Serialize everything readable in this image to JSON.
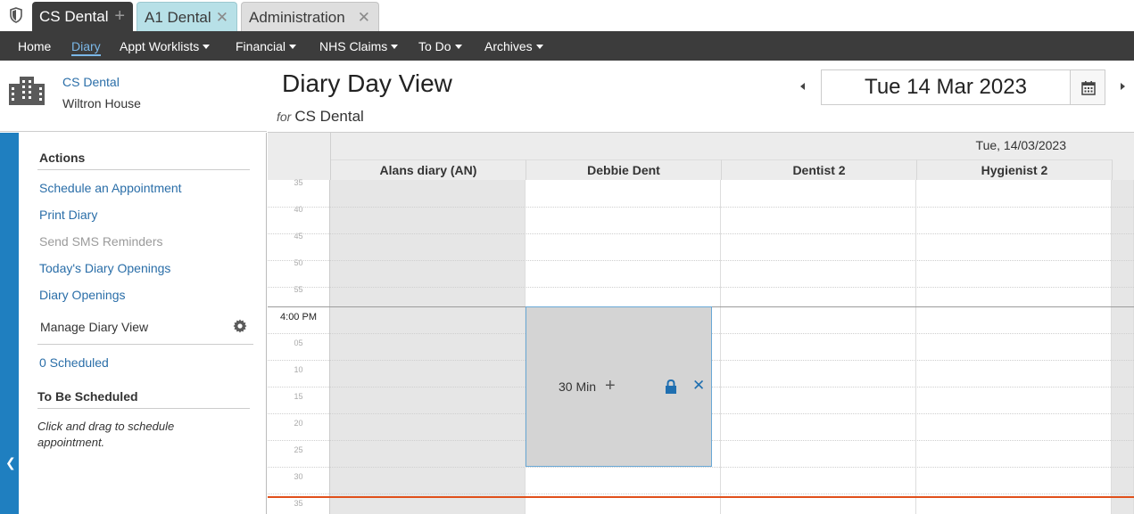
{
  "tabs": [
    {
      "label": "CS Dental",
      "icon": "plus-icon",
      "glyph": "+"
    },
    {
      "label": "A1 Dental",
      "icon": "close-icon",
      "glyph": "✕"
    },
    {
      "label": "Administration",
      "icon": "close-icon",
      "glyph": "✕"
    }
  ],
  "nav": {
    "home": "Home",
    "diary": "Diary",
    "appt_worklists": "Appt Worklists",
    "financial": "Financial",
    "nhs_claims": "NHS Claims",
    "todo": "To Do",
    "archives": "Archives"
  },
  "practice": {
    "name": "CS Dental",
    "site": "Wiltron House",
    "icon": "building-icon"
  },
  "actions": {
    "title": "Actions",
    "items": [
      "Schedule an Appointment",
      "Print Diary",
      "Send SMS Reminders",
      "Today's Diary Openings",
      "Diary Openings"
    ]
  },
  "manage": {
    "title": "Manage Diary View",
    "scheduled": "0 Scheduled"
  },
  "to_be_scheduled": {
    "title": "To Be Scheduled",
    "hint": "Click and drag to schedule appointment."
  },
  "header": {
    "title": "Diary Day View",
    "for": "for",
    "practice": "CS Dental",
    "date": "Tue 14 Mar 2023"
  },
  "grid": {
    "date_label": "Tue, 14/03/2023",
    "columns": [
      "Alans diary (AN)",
      "Debbie Dent",
      "Dentist 2",
      "Hygienist 2"
    ],
    "times": [
      "35",
      "40",
      "45",
      "50",
      "55",
      "4:00 PM",
      "05",
      "10",
      "15",
      "20",
      "25",
      "30",
      "35"
    ]
  },
  "appointment": {
    "duration": "30 Min",
    "plus": "+",
    "close": "✕"
  },
  "colors": {
    "accent": "#1f7fc0",
    "now_line": "#e0501a",
    "link": "#2a6ea8",
    "nav_bg": "#3c3c3c"
  }
}
